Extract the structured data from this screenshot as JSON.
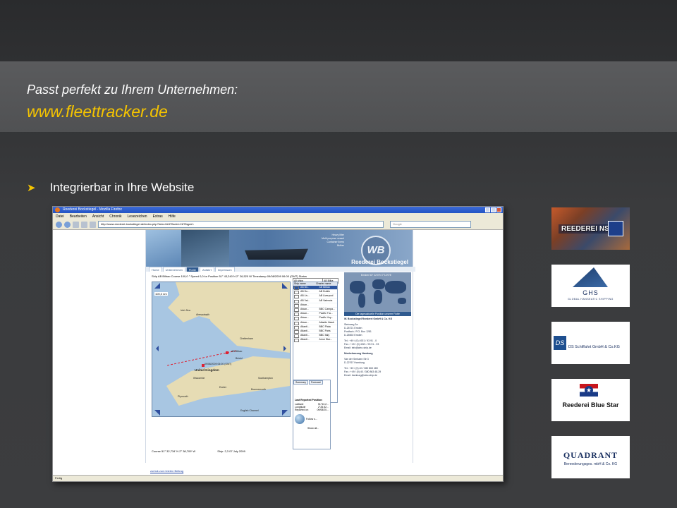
{
  "slide": {
    "tagline": "Passt perfekt zu Ihrem Unternehmen:",
    "url": "www.fleettracker.de",
    "bullet": "Integrierbar in Ihre Website"
  },
  "browser": {
    "window_title": "Reederei Bockstiegel - Mozilla Firefox",
    "menu": [
      "Datei",
      "Bearbeiten",
      "Ansicht",
      "Chronik",
      "Lesezeichen",
      "Extras",
      "Hilfe"
    ],
    "address": "http://www.reederei-bockstiegel.de/index.php?fwin=0#470seid=11f76qpd/=",
    "search_placeholder": "Google",
    "status": "Fertig"
  },
  "site": {
    "header_lines": [
      "Heavy lifter",
      "Multi purpose vessel",
      "Container liners",
      "Bulker"
    ],
    "logo_mark": "WB",
    "brand": "Reederei Bockstiegel",
    "nav": [
      "Home",
      "Unternehmen",
      "Flotte",
      "Anfahrt",
      "Impressum"
    ],
    "ship_bar": "Ship  AB Bilbao  Course  100,0 °  Speed  0,0 kn  Position  51° 43,240 N  2° 26,520 W  Timestamp  09/08/2009 06:00 (GMT)  Status",
    "course_bar_left": "Course  51° 32,734' N   2° 38,709' W",
    "course_bar_right": "Ship:                           2,3 07.July 2009",
    "back_link": "zurück zum letzten Beitrag",
    "map": {
      "scale": "100,0 nm",
      "labels": [
        "Irish Sea",
        "Aberystwyth",
        "Cheltenham",
        "Bristol",
        "United Kingdom",
        "Southampton",
        "Bournemouth",
        "English Channel",
        "Ilfracombe",
        "Plymouth",
        "Exeter",
        "AB Bilbao",
        "09/08/2009 06:00 (GMT)"
      ]
    },
    "shiplist": {
      "dropdown": "All ships",
      "dropdown2": "AB Bilba",
      "headers": [
        "Ship name",
        "Charter name"
      ],
      "rows": [
        [
          "AB Bil...",
          "AB Bilbao"
        ],
        [
          "AB Du...",
          "AB Dublin"
        ],
        [
          "AB Liv...",
          "AB Liverpool"
        ],
        [
          "AB Val...",
          "AB Valencia"
        ],
        [
          "Arkan...",
          ""
        ],
        [
          "Arkan...",
          "BBC Campa..."
        ],
        [
          "Arkan...",
          "Pacific Tra..."
        ],
        [
          "Arkan...",
          "Pacific Voy..."
        ],
        [
          "Arkan...",
          "Atlantic Hawk"
        ],
        [
          "Atlanti...",
          "BBC Plata"
        ],
        [
          "Atlanti...",
          "BBC Paris"
        ],
        [
          "Atlanti...",
          "BBC Italy"
        ],
        [
          "Atlanti...",
          "Amur Star..."
        ]
      ]
    },
    "panel": {
      "tabs": [
        "Summary",
        "Forecast"
      ],
      "title": "Last Reported Position:",
      "rows": [
        [
          "Latitude",
          "51°43.2..."
        ],
        [
          "Longitude",
          "2°26.52..."
        ],
        [
          "Reported on",
          "09/08/20..."
        ]
      ],
      "follow": "Follow s...",
      "show_all": "Show all..."
    },
    "side": {
      "world_title": "Emden  53° 22'0\"N  7°12'0\"E",
      "caption": "Die tagesaktuelle Position unserer Flotte",
      "company": "W. Bockstiegel Reederei GmbH & Co. KG",
      "address": [
        "Steinweg 3a",
        "D-26721 Emden",
        "Postfach / P.O. Box 1281",
        "D-26692 Emden"
      ],
      "contact": [
        "Tel.: +49 / (0) 4921 / 93 91 - 0",
        "Fax.: +49 / (0) 4921 / 93 91 - 93",
        "Email: info@wbo-ship.de"
      ],
      "branch": "Niederlassung Hamburg",
      "branch_address": [
        "Van der Smissen Str 3",
        "D-22767 Hamburg"
      ],
      "branch_contact": [
        "Tel.: +49 / (0) 40 / 380 863 480",
        "Fax.: +49 / (0) 40 / 380 863 48-29",
        "Email: hamburg@wbo-ship.de"
      ]
    }
  },
  "logos": {
    "nsb": "REEDEREI NSB",
    "ghs": "GHS",
    "ghs_sub": "GLOBAL HANSEATIC SHIPPING",
    "ds_mark": "DS",
    "ds": "DS Schiffahrt GmbH & Co.KG",
    "bluestar": "Reederei Blue Star",
    "quadrant": "QUADRANT",
    "quadrant_sub": "Bereederungsges. mbH & Co. KG"
  },
  "colors": {
    "accent_yellow": "#f5c400",
    "site_blue": "#2f5a8f"
  }
}
